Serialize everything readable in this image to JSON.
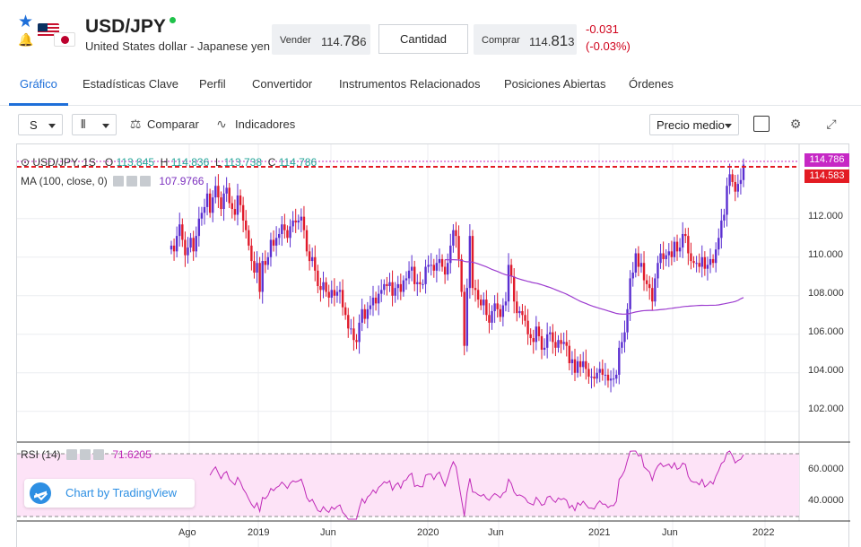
{
  "header": {
    "title": "USD/JPY",
    "subtitle": "United States dollar - Japanese yen",
    "sell_label": "Vender",
    "sell_price_main": "114.",
    "sell_price_big": "78",
    "sell_price_tail": "6",
    "qty_label": "Cantidad",
    "buy_label": "Comprar",
    "buy_price_main": "114.",
    "buy_price_big": "81",
    "buy_price_tail": "3",
    "change_abs": "-0.031",
    "change_pct": "(-0.03%)",
    "change_color": "#d0021b",
    "live_color": "#1fc24a"
  },
  "tabs": [
    {
      "label": "Gráfico"
    },
    {
      "label": "Estadísticas Clave"
    },
    {
      "label": "Perfil"
    },
    {
      "label": "Convertidor"
    },
    {
      "label": "Instrumentos Relacionados"
    },
    {
      "label": "Posiciones Abiertas"
    },
    {
      "label": "Órdenes"
    }
  ],
  "toolbar": {
    "interval": "S",
    "compare": "Comparar",
    "indicators": "Indicadores",
    "price_mode": "Precio medio"
  },
  "legend": {
    "symbol": "USD/JPY, 1S",
    "o_key": "O",
    "o_val": "113.845",
    "h_key": "H",
    "h_val": "114.836",
    "l_key": "L",
    "l_val": "113.738",
    "c_key": "C",
    "c_val": "114.786",
    "ma_label": "MA (100, close, 0)",
    "ma_val": "107.9766",
    "rsi_label": "RSI (14)",
    "rsi_val": "71.6205"
  },
  "badge": {
    "text": "Chart by TradingView"
  },
  "price_tags": {
    "high": "114.786",
    "last": "114.583"
  },
  "y_axis": [
    "112.000",
    "110.000",
    "108.000",
    "106.000",
    "104.000",
    "102.000"
  ],
  "rsi_axis": [
    "60.0000",
    "40.0000"
  ],
  "x_axis": [
    "Ago",
    "2019",
    "Jun",
    "2020",
    "Jun",
    "2021",
    "Jun",
    "2022"
  ],
  "chart_data": {
    "type": "candlestick",
    "series_name": "USD/JPY, 1S",
    "ylim": [
      100.5,
      115.2
    ],
    "close": [
      110.6,
      110.3,
      111.1,
      111.7,
      110.9,
      110.1,
      110.5,
      111.0,
      110.3,
      111.1,
      112.0,
      112.3,
      112.6,
      113.3,
      112.3,
      113.1,
      113.7,
      113.1,
      112.5,
      113.3,
      113.6,
      112.8,
      112.5,
      112.2,
      113.2,
      112.7,
      111.9,
      111.4,
      110.6,
      109.8,
      109.2,
      109.7,
      108.2,
      109.8,
      109.6,
      110.0,
      110.9,
      110.6,
      111.0,
      111.2,
      111.7,
      111.4,
      111.0,
      111.6,
      111.9,
      111.8,
      111.9,
      112.1,
      111.4,
      110.3,
      109.8,
      110.0,
      109.3,
      108.5,
      108.3,
      108.7,
      108.2,
      107.9,
      108.3,
      108.0,
      108.2,
      108.3,
      107.4,
      107.0,
      106.3,
      106.3,
      105.7,
      105.6,
      106.6,
      107.3,
      106.8,
      107.3,
      107.5,
      107.9,
      107.6,
      108.1,
      108.3,
      108.6,
      108.5,
      108.7,
      108.0,
      108.4,
      108.6,
      108.2,
      108.8,
      108.9,
      109.3,
      109.5,
      108.6,
      108.7,
      108.6,
      108.6,
      109.5,
      109.6,
      109.6,
      109.3,
      109.7,
      109.9,
      109.5,
      109.1,
      109.7,
      110.6,
      111.4,
      111.1,
      109.9,
      108.2,
      105.4,
      108.4,
      111.1,
      108.4,
      108.3,
      107.8,
      107.5,
      107.8,
      107.0,
      106.6,
      107.2,
      107.6,
      107.3,
      106.9,
      107.5,
      107.7,
      109.6,
      109.0,
      107.7,
      107.1,
      107.2,
      107.0,
      106.7,
      106.0,
      105.8,
      105.6,
      106.4,
      105.9,
      105.2,
      105.3,
      106.0,
      106.1,
      105.6,
      105.3,
      105.7,
      105.5,
      105.6,
      105.4,
      104.5,
      104.7,
      104.0,
      104.6,
      104.3,
      104.6,
      104.2,
      103.8,
      103.8,
      103.7,
      104.0,
      104.2,
      103.9,
      103.9,
      103.6,
      103.7,
      103.7,
      103.9,
      105.3,
      105.6,
      106.1,
      107.3,
      108.9,
      109.2,
      110.2,
      109.5,
      109.7,
      108.8,
      108.6,
      108.4,
      107.7,
      108.9,
      109.7,
      110.2,
      109.9,
      110.1,
      110.3,
      110.0,
      110.8,
      110.3,
      110.5,
      111.2,
      111.1,
      110.2,
      109.8,
      109.7,
      109.7,
      109.5,
      110.0,
      109.4,
      109.6,
      109.9,
      109.7,
      110.4,
      111.0,
      111.9,
      112.2,
      113.7,
      114.3,
      113.9,
      113.4,
      113.8,
      114.0,
      114.8
    ]
  },
  "colors": {
    "up": "#5b2fd1",
    "down": "#e01b2b",
    "ma": "#9c3ccf",
    "rsi": "#c02ab8",
    "rsi_band": "#fde3f7"
  }
}
